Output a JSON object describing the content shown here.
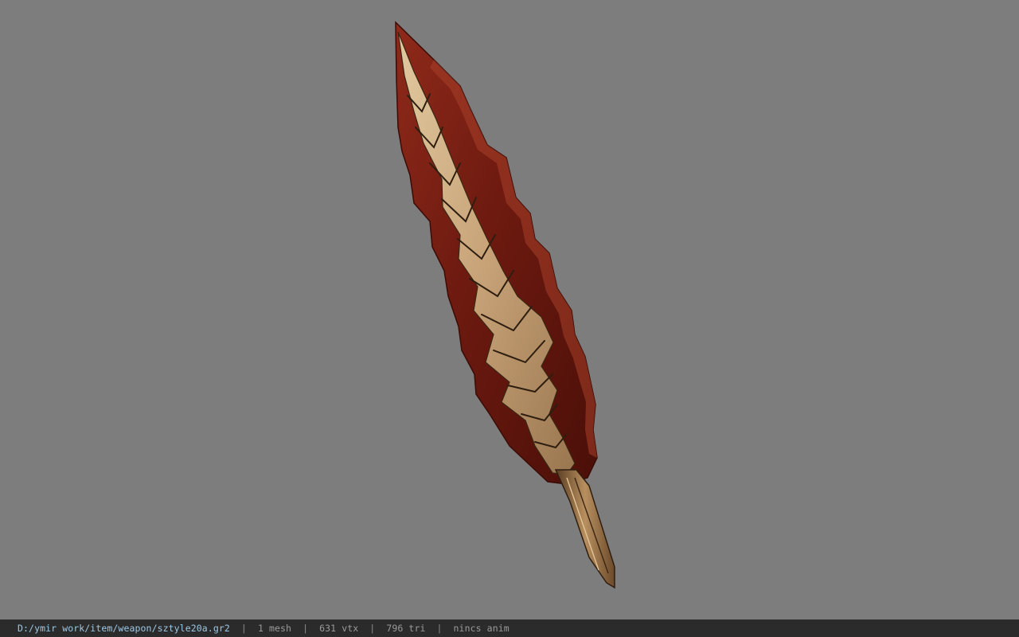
{
  "viewer": {
    "background_color": "#7d7d7d",
    "model_icon": "sword-blade-model"
  },
  "status_bar": {
    "file_path": "D:/ymir work/item/weapon/sztyle20a.gr2",
    "separator": "|",
    "mesh_count": "1 mesh",
    "vertex_count": "631 vtx",
    "triangle_count": "796 tri",
    "anim_info": "nincs anim",
    "colors": {
      "background": "#2b2b2b",
      "path_text": "#9cc8e6",
      "stat_text": "#9a9a9a"
    }
  }
}
